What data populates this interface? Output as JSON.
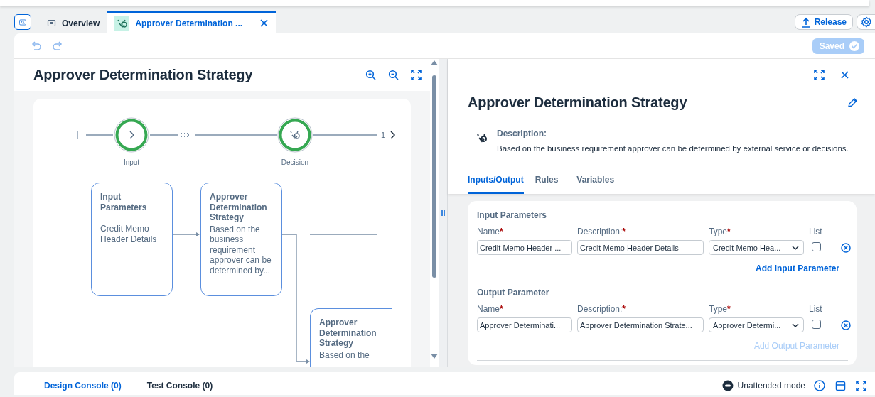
{
  "top_tabs": [
    {
      "kind": "overview",
      "label": "Overview",
      "selected": false
    },
    {
      "kind": "model",
      "label": "Approver Determination ...",
      "selected": true
    }
  ],
  "header_actions": {
    "release": "Release"
  },
  "editor": {
    "saved": "Saved"
  },
  "diagram": {
    "title": "Approver Determination Strategy",
    "steps": [
      {
        "kind": "input",
        "label": "Input"
      },
      {
        "kind": "decision",
        "label": "Decision"
      }
    ],
    "branch_count": "1",
    "nodes": [
      {
        "title": "Input Parameters",
        "text": "Credit Memo Header Details"
      },
      {
        "title": "Approver Determination Strategy",
        "text": "Based on the business requirement approver can be determined by..."
      },
      {
        "title": "Approver Determination Strategy",
        "text": "Based on the"
      }
    ]
  },
  "details": {
    "title": "Approver Determination Strategy",
    "description_label": "Description:",
    "description": "Based on the business requirement approver can be determined by external service or decisions.",
    "tabs": [
      {
        "label": "Inputs/Output",
        "selected": true
      },
      {
        "label": "Rules",
        "selected": false
      },
      {
        "label": "Variables",
        "selected": false
      }
    ],
    "sections": [
      {
        "title": "Input Parameters",
        "columns": [
          {
            "label": "Name",
            "required": true
          },
          {
            "label": "Description:",
            "required": true
          },
          {
            "label": "Type",
            "required": true
          },
          {
            "label": "List",
            "required": false
          }
        ],
        "rows": [
          {
            "name": "Credit Memo Header ...",
            "description": "Credit Memo Header Details",
            "type": "Credit Memo Hea...",
            "list": false
          }
        ],
        "add_action": {
          "label": "Add Input Parameter",
          "disabled": false
        }
      },
      {
        "title": "Output Parameter",
        "columns": [
          {
            "label": "Name",
            "required": true
          },
          {
            "label": "Description:",
            "required": true
          },
          {
            "label": "Type",
            "required": true
          },
          {
            "label": "List",
            "required": false
          }
        ],
        "rows": [
          {
            "name": "Approver Determinati...",
            "description": "Approver Determination Strate...",
            "type": "Approver Determi...",
            "list": false
          }
        ],
        "add_action": {
          "label": "Add Output Parameter",
          "disabled": true
        }
      }
    ]
  },
  "required_mark": "*",
  "console": {
    "tabs": [
      {
        "label": "Design Console (0)",
        "selected": true
      },
      {
        "label": "Test Console (0)",
        "selected": false
      }
    ],
    "mode": "Unattended mode"
  }
}
